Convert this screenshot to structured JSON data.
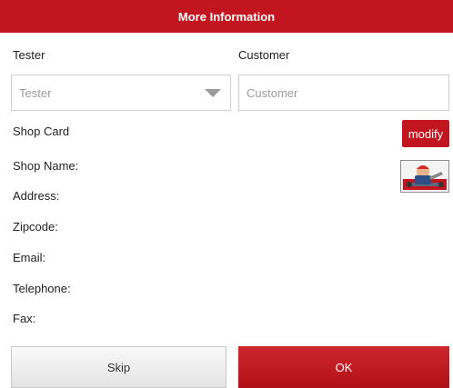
{
  "title": "More Information",
  "tester": {
    "label": "Tester",
    "placeholder": "Tester"
  },
  "customer": {
    "label": "Customer",
    "placeholder": "Customer"
  },
  "shop_card": {
    "label": "Shop Card",
    "modify_label": "modify",
    "fields": {
      "shop_name": "Shop Name:",
      "address": "Address:",
      "zipcode": "Zipcode:",
      "email": "Email:",
      "telephone": "Telephone:",
      "fax": "Fax:"
    }
  },
  "buttons": {
    "skip": "Skip",
    "ok": "OK"
  },
  "colors": {
    "accent": "#c1161f"
  }
}
